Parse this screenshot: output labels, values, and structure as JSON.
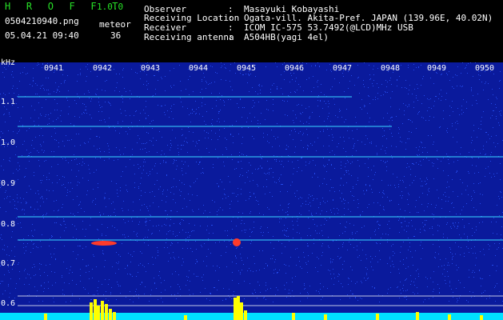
{
  "header": {
    "app_title": "H R O F F T",
    "app_version": "1.0.0",
    "file_name": "0504210940.png",
    "meteor_label": "meteor",
    "datetime": "05.04.21 09:40",
    "meteor_count": "36",
    "info": [
      {
        "label": "Observer",
        "value": "Masayuki Kobayashi"
      },
      {
        "label": "Receiving Location",
        "value": "Ogata-vill. Akita-Pref. JAPAN (139.96E, 40.02N)"
      },
      {
        "label": "Receiver",
        "value": "ICOM IC-575 53.7492(@LCD)MHz USB"
      },
      {
        "label": "Receiving antenna",
        "value": "A504HB(yagi 4el)"
      }
    ],
    "separator": ":"
  },
  "spectrogram": {
    "unit": "kHz",
    "y_ticks": [
      "1.1",
      "1.0",
      "0.9",
      "0.8",
      "0.7",
      "0.6"
    ],
    "x_ticks": [
      "0941",
      "0942",
      "0943",
      "0944",
      "0945",
      "0946",
      "0947",
      "0948",
      "0949",
      "0950"
    ],
    "colors": {
      "background": "#0a1a9c",
      "noise": "#2a56ff",
      "line": "#3ad0ff",
      "echo": "#ff3b2a",
      "baseline": "#00e0ff",
      "peaks": "#ffff00"
    }
  }
}
